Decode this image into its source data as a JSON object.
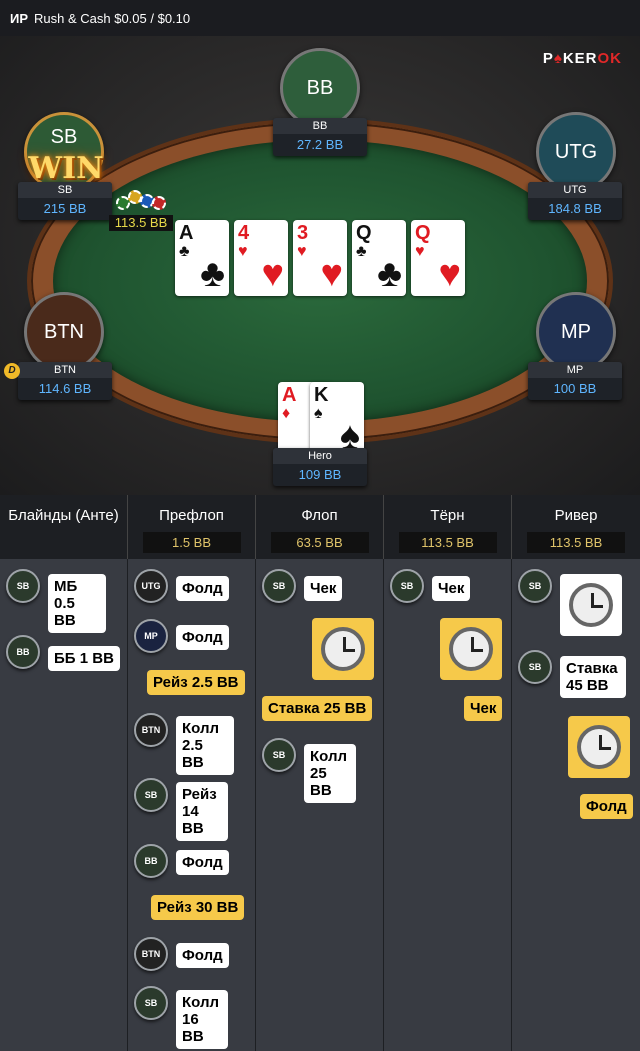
{
  "topbar": {
    "game_tag": "ИР",
    "game_name": "Rush & Cash $0.05 / $0.10"
  },
  "logo": {
    "text_a": "P",
    "text_b": "KER",
    "text_c": "K"
  },
  "table": {
    "seats": {
      "bb": {
        "label": "BB",
        "name": "BB",
        "stack": "27.2 BB"
      },
      "utg": {
        "label": "UTG",
        "name": "UTG",
        "stack": "184.8 BB"
      },
      "sb": {
        "label": "SB",
        "name": "SB",
        "stack": "215 BB"
      },
      "btn": {
        "label": "BTN",
        "name": "BTN",
        "stack": "114.6 BB"
      },
      "mp": {
        "label": "MP",
        "name": "MP",
        "stack": "100 BB"
      },
      "hero": {
        "name": "Hero",
        "stack": "109 BB"
      }
    },
    "win_text": "WIN",
    "pot_chips": "113.5 BB",
    "dealer_button": "D",
    "board": [
      {
        "rank": "A",
        "suit": "♣"
      },
      {
        "rank": "4",
        "suit": "♥"
      },
      {
        "rank": "3",
        "suit": "♥"
      },
      {
        "rank": "Q",
        "suit": "♣"
      },
      {
        "rank": "Q",
        "suit": "♥"
      }
    ],
    "hero_cards": [
      {
        "rank": "A",
        "suit": "♦"
      },
      {
        "rank": "K",
        "suit": "♠"
      }
    ]
  },
  "streets": [
    {
      "title": "Блайнды (Анте)",
      "pot": ""
    },
    {
      "title": "Префлоп",
      "pot": "1.5 BB"
    },
    {
      "title": "Флоп",
      "pot": "63.5 BB"
    },
    {
      "title": "Тёрн",
      "pot": "113.5 BB"
    },
    {
      "title": "Ривер",
      "pot": "113.5 BB"
    }
  ],
  "actions": {
    "blinds": [
      {
        "pos": "SB",
        "text": "МБ 0.5 BB"
      },
      {
        "pos": "BB",
        "text": "ББ 1 BB"
      }
    ],
    "preflop": [
      {
        "pos": "UTG",
        "text": "Фолд"
      },
      {
        "pos": "MP",
        "text": "Фолд"
      },
      {
        "pos": "",
        "text": "Рейз 2.5 BB"
      },
      {
        "pos": "BTN",
        "text": "Колл 2.5 BB"
      },
      {
        "pos": "SB",
        "text": "Рейз 14 BB"
      },
      {
        "pos": "BB",
        "text": "Фолд"
      },
      {
        "pos": "",
        "text": "Рейз 30 BB"
      },
      {
        "pos": "BTN",
        "text": "Фолд"
      },
      {
        "pos": "SB",
        "text": "Колл 16 BB"
      }
    ],
    "flop": [
      {
        "pos": "SB",
        "text": "Чек"
      },
      {
        "pos": "",
        "text": "Ставка 25 BB"
      },
      {
        "pos": "SB",
        "text": "Колл 25 BB"
      }
    ],
    "turn": [
      {
        "pos": "SB",
        "text": "Чек"
      },
      {
        "pos": "",
        "text": "Чек"
      }
    ],
    "river": [
      {
        "pos": "SB",
        "text": ""
      },
      {
        "pos": "SB",
        "text": "Ставка 45 BB"
      },
      {
        "pos": "",
        "text": "Фолд"
      }
    ]
  },
  "colors": {
    "felt": "#1f5430",
    "rail": "#8b4f2a",
    "hero_bubble": "#f6c94a",
    "stack_text": "#5fb6ff",
    "pot_text": "#e0c46a"
  }
}
